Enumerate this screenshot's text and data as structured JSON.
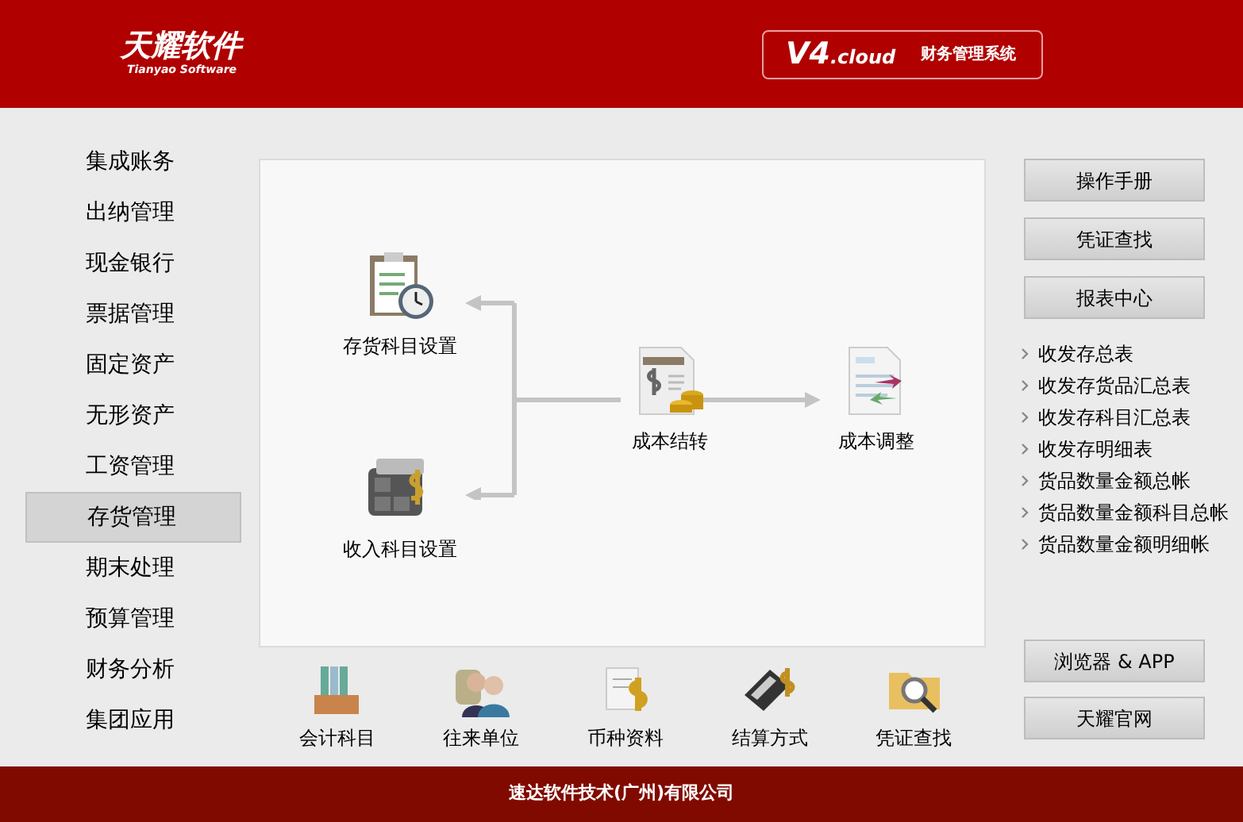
{
  "header": {
    "logo": "天耀软件",
    "logo_sub": "Tianyao Software",
    "version": "V4",
    "version_suffix": ".cloud",
    "product": "财务管理系统"
  },
  "sidebar": {
    "items": [
      {
        "label": "集成账务",
        "selected": false
      },
      {
        "label": "出纳管理",
        "selected": false
      },
      {
        "label": "现金银行",
        "selected": false
      },
      {
        "label": "票据管理",
        "selected": false
      },
      {
        "label": "固定资产",
        "selected": false
      },
      {
        "label": "无形资产",
        "selected": false
      },
      {
        "label": "工资管理",
        "selected": false
      },
      {
        "label": "存货管理",
        "selected": true
      },
      {
        "label": "期末处理",
        "selected": false
      },
      {
        "label": "预算管理",
        "selected": false
      },
      {
        "label": "财务分析",
        "selected": false
      },
      {
        "label": "集团应用",
        "selected": false
      }
    ]
  },
  "diagram": {
    "nodes": [
      {
        "label": "存货科目设置"
      },
      {
        "label": "收入科目设置"
      },
      {
        "label": "成本结转"
      },
      {
        "label": "成本调整"
      }
    ]
  },
  "shortcuts": [
    {
      "label": "会计科目"
    },
    {
      "label": "往来单位"
    },
    {
      "label": "币种资料"
    },
    {
      "label": "结算方式"
    },
    {
      "label": "凭证查找"
    }
  ],
  "right_panel": {
    "buttons": [
      "操作手册",
      "凭证查找",
      "报表中心"
    ],
    "reports": [
      "收发存总表",
      "收发存货品汇总表",
      "收发存科目汇总表",
      "收发存明细表",
      "货品数量金额总帐",
      "货品数量金额科目总帐",
      "货品数量金额明细帐"
    ],
    "bottom_buttons": [
      "浏览器 & APP",
      "天耀官网"
    ]
  },
  "footer": "速达软件技术(广州)有限公司"
}
